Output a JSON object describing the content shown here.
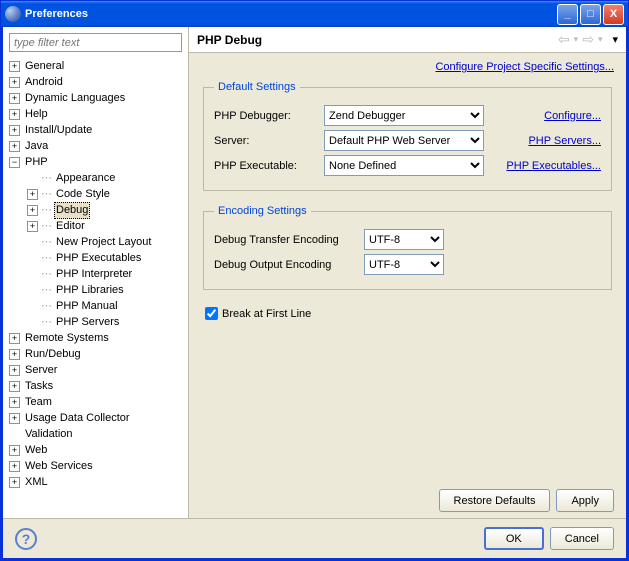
{
  "window": {
    "title": "Preferences"
  },
  "filter": {
    "placeholder": "type filter text"
  },
  "tree": [
    {
      "label": "General",
      "depth": 0,
      "exp": "+"
    },
    {
      "label": "Android",
      "depth": 0,
      "exp": "+"
    },
    {
      "label": "Dynamic Languages",
      "depth": 0,
      "exp": "+"
    },
    {
      "label": "Help",
      "depth": 0,
      "exp": "+"
    },
    {
      "label": "Install/Update",
      "depth": 0,
      "exp": "+"
    },
    {
      "label": "Java",
      "depth": 0,
      "exp": "+"
    },
    {
      "label": "PHP",
      "depth": 0,
      "exp": "-"
    },
    {
      "label": "Appearance",
      "depth": 1,
      "exp": ""
    },
    {
      "label": "Code Style",
      "depth": 1,
      "exp": "+"
    },
    {
      "label": "Debug",
      "depth": 1,
      "exp": "+",
      "selected": true
    },
    {
      "label": "Editor",
      "depth": 1,
      "exp": "+"
    },
    {
      "label": "New Project Layout",
      "depth": 1,
      "exp": ""
    },
    {
      "label": "PHP Executables",
      "depth": 1,
      "exp": ""
    },
    {
      "label": "PHP Interpreter",
      "depth": 1,
      "exp": ""
    },
    {
      "label": "PHP Libraries",
      "depth": 1,
      "exp": ""
    },
    {
      "label": "PHP Manual",
      "depth": 1,
      "exp": ""
    },
    {
      "label": "PHP Servers",
      "depth": 1,
      "exp": ""
    },
    {
      "label": "Remote Systems",
      "depth": 0,
      "exp": "+"
    },
    {
      "label": "Run/Debug",
      "depth": 0,
      "exp": "+"
    },
    {
      "label": "Server",
      "depth": 0,
      "exp": "+"
    },
    {
      "label": "Tasks",
      "depth": 0,
      "exp": "+"
    },
    {
      "label": "Team",
      "depth": 0,
      "exp": "+"
    },
    {
      "label": "Usage Data Collector",
      "depth": 0,
      "exp": "+"
    },
    {
      "label": "Validation",
      "depth": 0,
      "exp": ""
    },
    {
      "label": "Web",
      "depth": 0,
      "exp": "+"
    },
    {
      "label": "Web Services",
      "depth": 0,
      "exp": "+"
    },
    {
      "label": "XML",
      "depth": 0,
      "exp": "+"
    }
  ],
  "page": {
    "title": "PHP Debug",
    "projectLink": "Configure Project Specific Settings...",
    "defaultGroup": "Default Settings",
    "debuggerLabel": "PHP Debugger:",
    "debuggerValue": "Zend Debugger",
    "debuggerLink": "Configure...",
    "serverLabel": "Server:",
    "serverValue": "Default PHP Web Server",
    "serverLink": "PHP Servers...",
    "exeLabel": "PHP Executable:",
    "exeValue": "None Defined",
    "exeLink": "PHP Executables...",
    "encGroup": "Encoding Settings",
    "encTransferLabel": "Debug Transfer Encoding",
    "encTransferValue": "UTF-8",
    "encOutputLabel": "Debug Output Encoding",
    "encOutputValue": "UTF-8",
    "breakLabel": "Break at First Line",
    "breakChecked": true
  },
  "buttons": {
    "restore": "Restore Defaults",
    "apply": "Apply",
    "ok": "OK",
    "cancel": "Cancel"
  }
}
